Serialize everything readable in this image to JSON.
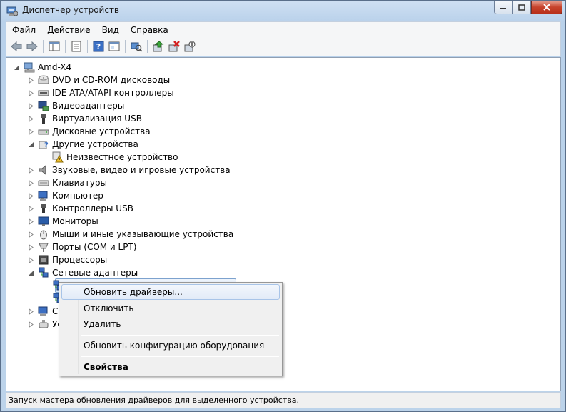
{
  "window": {
    "title": "Диспетчер устройств"
  },
  "menu": {
    "items": [
      "Файл",
      "Действие",
      "Вид",
      "Справка"
    ]
  },
  "toolbar": {
    "buttons": [
      "back-icon",
      "forward-icon",
      "show-hide-tree-icon",
      "properties-icon",
      "help-icon",
      "scan-hardware-icon",
      "update-driver-icon",
      "uninstall-icon",
      "disable-icon"
    ]
  },
  "tree": {
    "root": "Amd-X4",
    "categories": [
      {
        "label": "DVD и CD-ROM дисководы",
        "icon": "cd-drive-icon"
      },
      {
        "label": "IDE ATA/ATAPI контроллеры",
        "icon": "ide-controller-icon"
      },
      {
        "label": "Видеоадаптеры",
        "icon": "display-adapter-icon"
      },
      {
        "label": "Виртуализация USB",
        "icon": "usb-icon"
      },
      {
        "label": "Дисковые устройства",
        "icon": "disk-drive-icon"
      },
      {
        "label": "Другие устройства",
        "icon": "other-devices-icon"
      },
      {
        "label": "Неизвестное устройство",
        "icon": "unknown-device-warning-icon"
      },
      {
        "label": "Звуковые, видео и игровые устройства",
        "icon": "speaker-icon"
      },
      {
        "label": "Клавиатуры",
        "icon": "keyboard-icon"
      },
      {
        "label": "Компьютер",
        "icon": "computer-icon"
      },
      {
        "label": "Контроллеры USB",
        "icon": "usb-controller-icon"
      },
      {
        "label": "Мониторы",
        "icon": "monitor-icon"
      },
      {
        "label": "Мыши и иные указывающие устройства",
        "icon": "mouse-icon"
      },
      {
        "label": "Порты (COM и LPT)",
        "icon": "port-icon"
      },
      {
        "label": "Процессоры",
        "icon": "processor-icon"
      },
      {
        "label": "Сетевые адаптеры",
        "icon": "network-adapter-icon"
      },
      {
        "label": "",
        "icon": "network-adapter-icon"
      },
      {
        "label": "",
        "icon": "network-adapter-icon"
      },
      {
        "label": "С",
        "icon": "system-devices-icon"
      },
      {
        "label": "Ус",
        "icon": "hid-device-icon"
      }
    ]
  },
  "context_menu": {
    "items": [
      {
        "label": "Обновить драйверы..."
      },
      {
        "label": "Отключить"
      },
      {
        "label": "Удалить"
      },
      {
        "label": "Обновить конфигурацию оборудования"
      },
      {
        "label": "Свойства"
      }
    ]
  },
  "status": {
    "text": "Запуск мастера обновления драйверов для выделенного устройства."
  }
}
